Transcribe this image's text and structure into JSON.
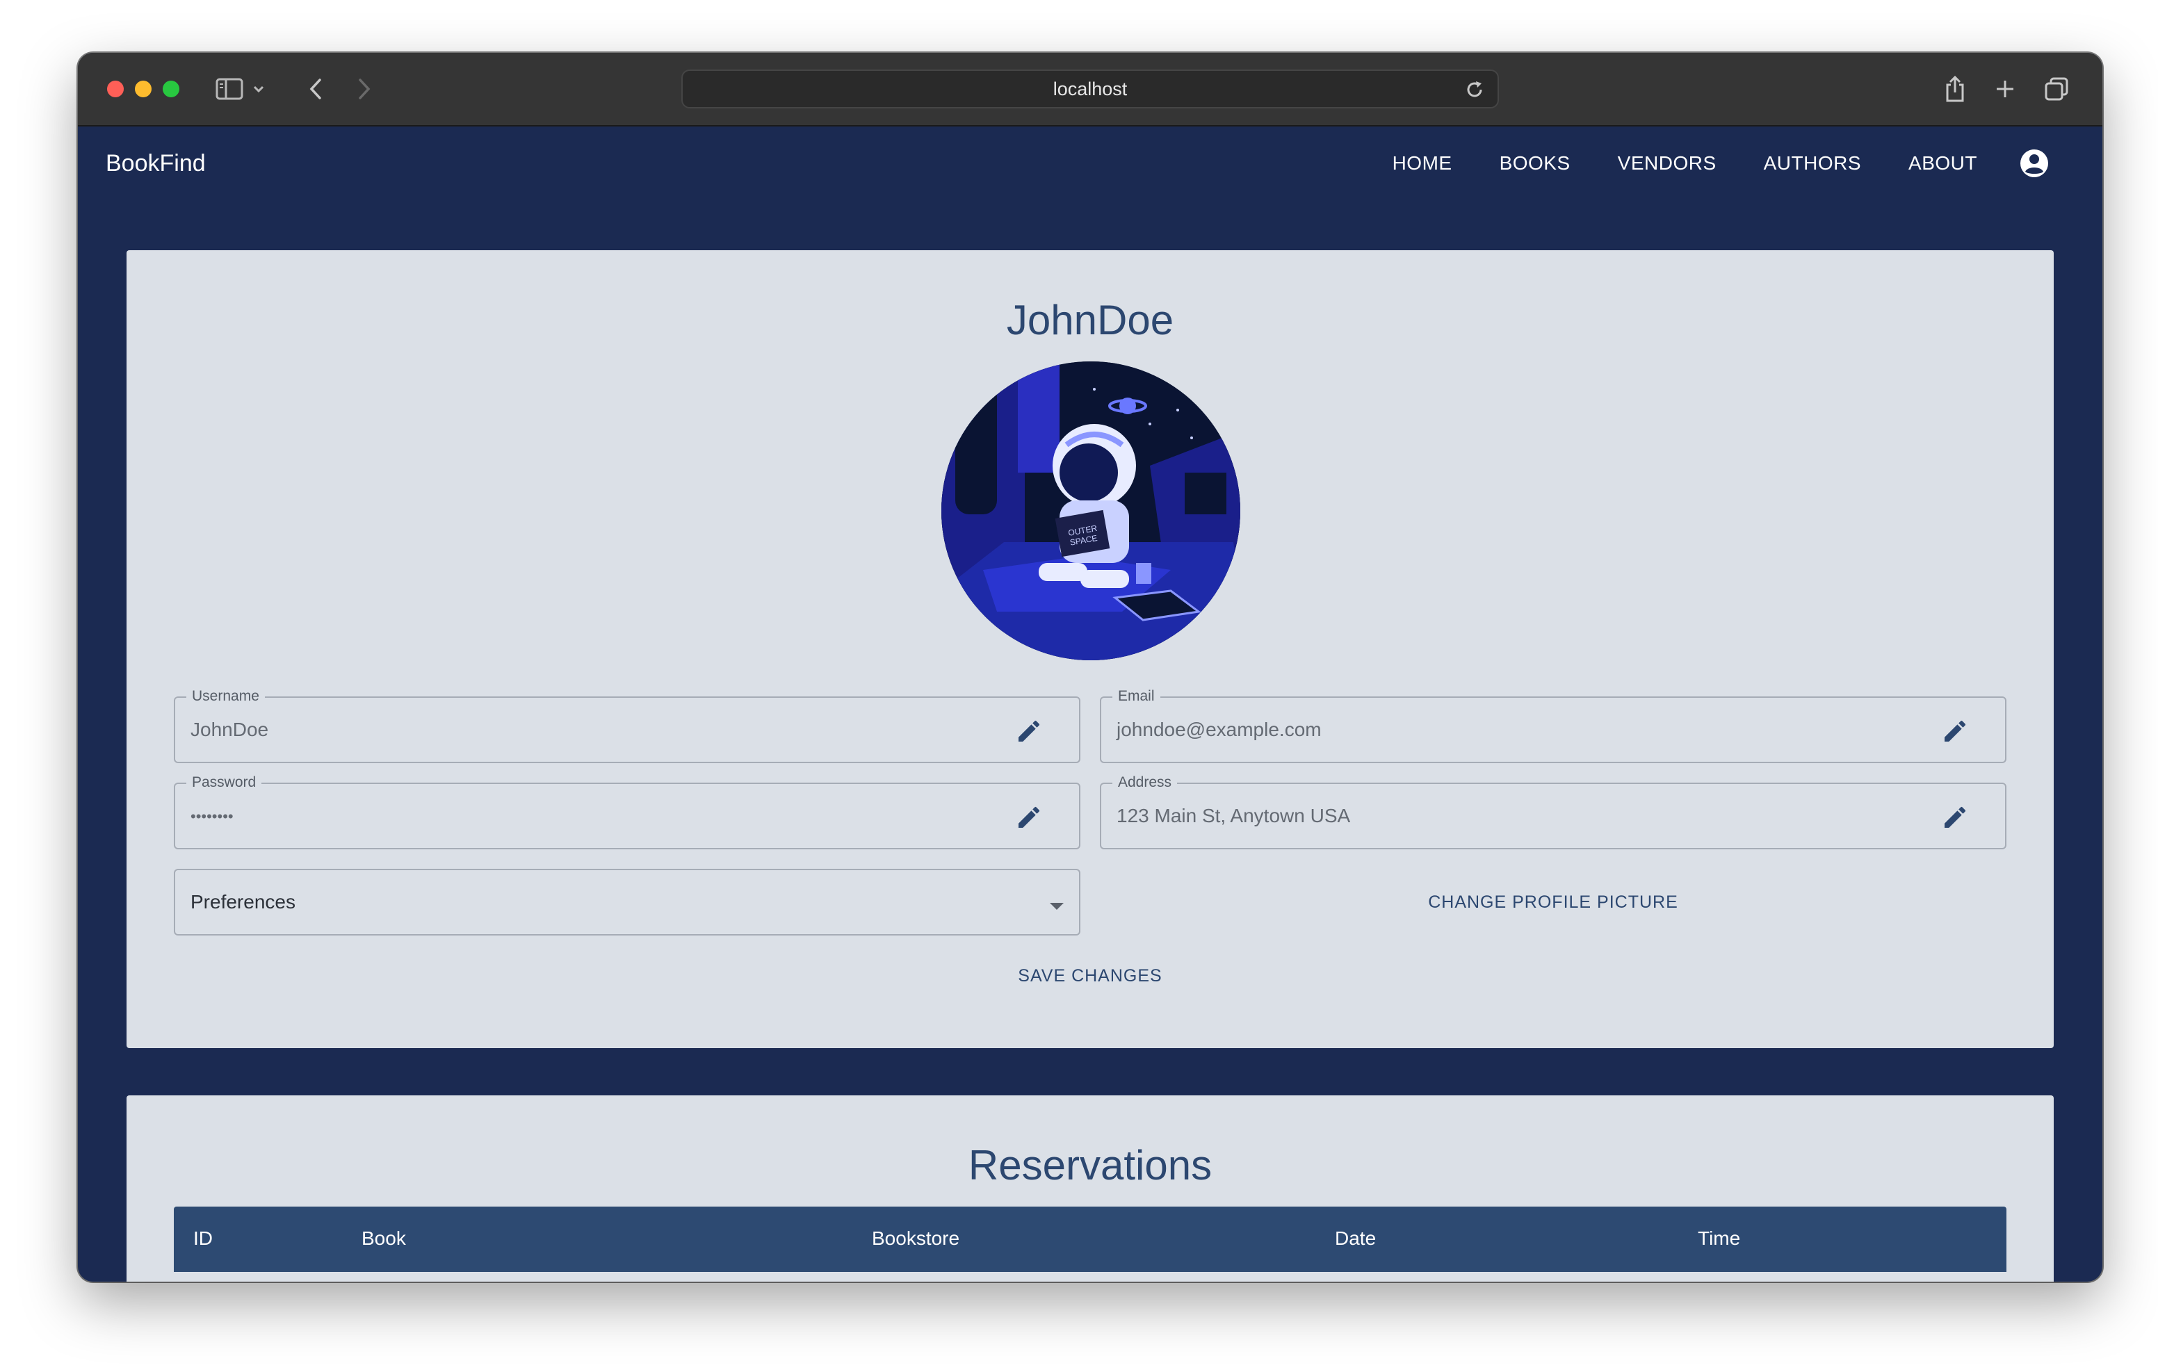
{
  "browser": {
    "url": "localhost"
  },
  "app": {
    "brand": "BookFind",
    "nav": [
      "HOME",
      "BOOKS",
      "VENDORS",
      "AUTHORS",
      "ABOUT"
    ]
  },
  "profile": {
    "username_heading": "JohnDoe",
    "fields": {
      "username": {
        "label": "Username",
        "value": "JohnDoe"
      },
      "email": {
        "label": "Email",
        "value": "johndoe@example.com"
      },
      "password": {
        "label": "Password",
        "value": "••••••••"
      },
      "address": {
        "label": "Address",
        "value": "123 Main St, Anytown USA"
      }
    },
    "preferences": {
      "value": "Preferences"
    },
    "change_picture_label": "CHANGE PROFILE PICTURE",
    "save_label": "SAVE CHANGES"
  },
  "reservations": {
    "title": "Reservations",
    "columns": [
      "ID",
      "Book",
      "Bookstore",
      "Date",
      "Time"
    ]
  },
  "colors": {
    "navy": "#1b2a52",
    "card": "#dbe0e7",
    "accent": "#2c4770",
    "table_header": "#2d4a72"
  },
  "icons": {
    "edit": "pencil-icon",
    "account": "account-circle-icon",
    "dropdown": "caret-down-icon"
  }
}
